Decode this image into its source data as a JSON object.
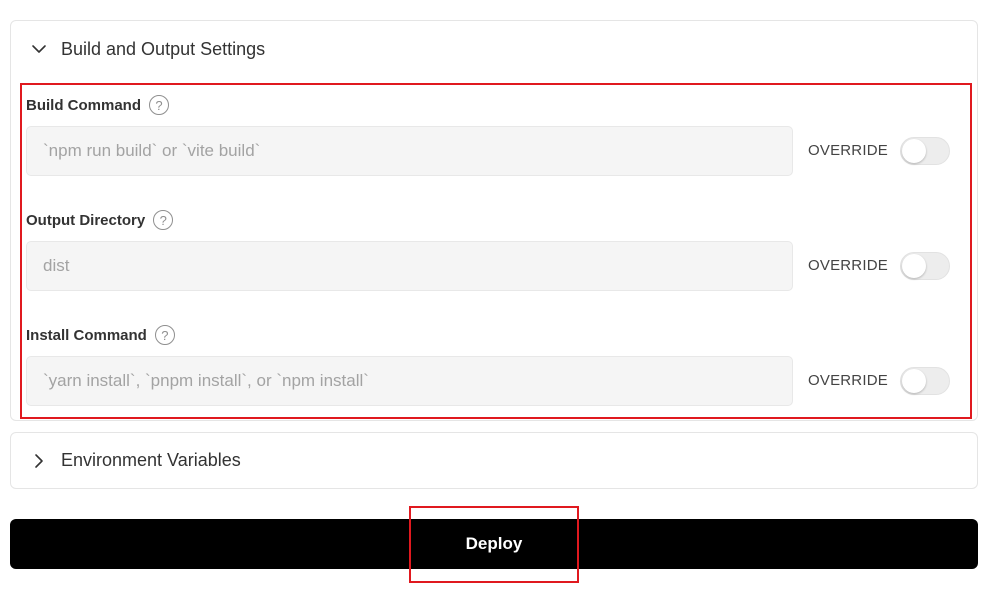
{
  "build_settings": {
    "title": "Build and Output Settings",
    "expanded": true,
    "chevron_icon": "chevron-down-icon",
    "help_glyph": "?",
    "fields": [
      {
        "label": "Build Command",
        "placeholder": "`npm run build` or `vite build`",
        "value": "",
        "override_label": "OVERRIDE",
        "override_on": false
      },
      {
        "label": "Output Directory",
        "placeholder": "dist",
        "value": "",
        "override_label": "OVERRIDE",
        "override_on": false
      },
      {
        "label": "Install Command",
        "placeholder": "`yarn install`, `pnpm install`, or `npm install`",
        "value": "",
        "override_label": "OVERRIDE",
        "override_on": false
      }
    ]
  },
  "env_vars": {
    "title": "Environment Variables",
    "expanded": false,
    "chevron_icon": "chevron-right-icon"
  },
  "deploy": {
    "label": "Deploy"
  },
  "colors": {
    "highlight": "#e0191f",
    "deploy_bg": "#000000",
    "deploy_text": "#ffffff"
  }
}
